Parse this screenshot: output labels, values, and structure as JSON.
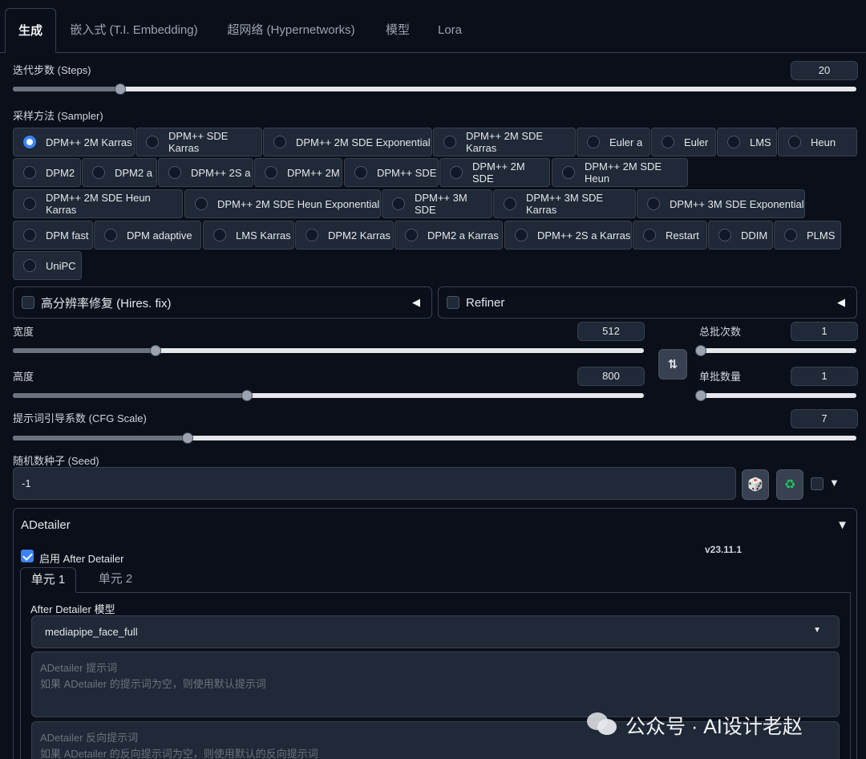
{
  "tabs": [
    "生成",
    "嵌入式 (T.I. Embedding)",
    "超网络 (Hypernetworks)",
    "模型",
    "Lora"
  ],
  "steps": {
    "label": "迭代步数 (Steps)",
    "value": "20",
    "min": 1,
    "max": 150
  },
  "sampler": {
    "label": "采样方法 (Sampler)",
    "selected": "DPM++ 2M Karras",
    "options": [
      "DPM++ 2M Karras",
      "DPM++ SDE Karras",
      "DPM++ 2M SDE Exponential",
      "DPM++ 2M SDE Karras",
      "Euler a",
      "Euler",
      "LMS",
      "Heun",
      "DPM2",
      "DPM2 a",
      "DPM++ 2S a",
      "DPM++ 2M",
      "DPM++ SDE",
      "DPM++ 2M SDE",
      "DPM++ 2M SDE Heun",
      "DPM++ 2M SDE Heun Karras",
      "DPM++ 2M SDE Heun Exponential",
      "DPM++ 3M SDE",
      "DPM++ 3M SDE Karras",
      "DPM++ 3M SDE Exponential",
      "DPM fast",
      "DPM adaptive",
      "LMS Karras",
      "DPM2 Karras",
      "DPM2 a Karras",
      "DPM++ 2S a Karras",
      "Restart",
      "DDIM",
      "PLMS",
      "UniPC"
    ]
  },
  "hires": {
    "label": "高分辨率修复 (Hires. fix)"
  },
  "refiner": {
    "label": "Refiner"
  },
  "width": {
    "label": "宽度",
    "value": "512",
    "min": 64,
    "max": 2048
  },
  "height": {
    "label": "高度",
    "value": "800",
    "min": 64,
    "max": 2048
  },
  "batch_count": {
    "label": "总批次数",
    "value": "1",
    "min": 1,
    "max": 100
  },
  "batch_size": {
    "label": "单批数量",
    "value": "1",
    "min": 1,
    "max": 8
  },
  "cfg": {
    "label": "提示词引导系数 (CFG Scale)",
    "value": "7",
    "min": 1,
    "max": 30
  },
  "seed": {
    "label": "随机数种子 (Seed)",
    "value": "-1"
  },
  "adetailer": {
    "title": "ADetailer",
    "enable_label": "启用 After Detailer",
    "enabled": true,
    "version": "v23.11.1",
    "unit_tabs": [
      "单元 1",
      "单元 2"
    ],
    "model_label": "After Detailer 模型",
    "model_value": "mediapipe_face_full",
    "prompt_title": "ADetailer 提示词",
    "prompt_placeholder": "如果 ADetailer 的提示词为空，则使用默认提示词",
    "neg_title": "ADetailer 反向提示词",
    "neg_placeholder": "如果 ADetailer 的反向提示词为空，则使用默认的反向提示词"
  },
  "watermark": "公众号 · AI设计老赵",
  "icons": {
    "swap": "swap-icon",
    "dice": "dice-icon",
    "recycle": "recycle-icon"
  }
}
